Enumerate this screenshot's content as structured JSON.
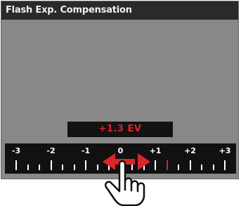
{
  "header": {
    "title": "Flash Exp. Compensation"
  },
  "display": {
    "value": "+1.3 EV",
    "accent_color": "#d8262a"
  },
  "scale": {
    "labels": [
      "-3",
      "-2",
      "-1",
      "0",
      "+1",
      "+2",
      "+3"
    ],
    "min": -3,
    "max": 3,
    "step": 0.3333,
    "selected_value": 1.3333,
    "selected_color": "#d8262a"
  },
  "gesture": {
    "icon": "swipe-hand-icon",
    "arrow_icon": "double-arrow-icon",
    "arrow_color": "#d8262a"
  }
}
